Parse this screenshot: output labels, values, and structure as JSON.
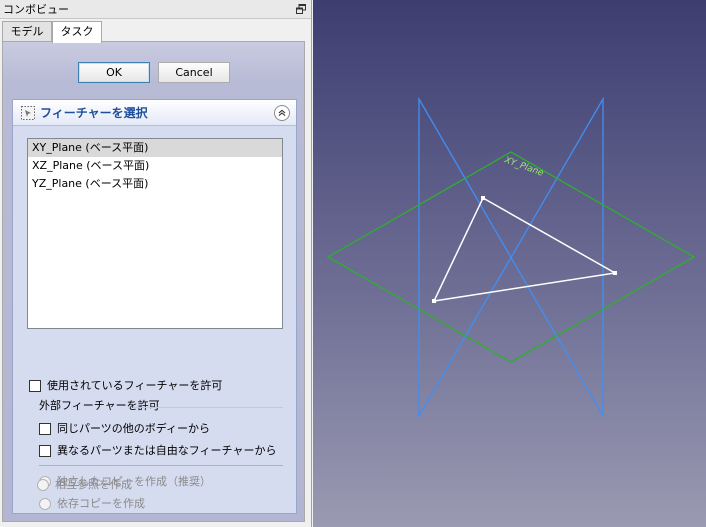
{
  "window": {
    "title": "コンボビュー"
  },
  "tabs": [
    {
      "label": "モデル",
      "active": false
    },
    {
      "label": "タスク",
      "active": true
    }
  ],
  "buttons": {
    "ok": "OK",
    "cancel": "Cancel"
  },
  "feature_box": {
    "title": "フィーチャーを選択",
    "items": [
      {
        "label": "XY_Plane (ベース平面)",
        "selected": true
      },
      {
        "label": "XZ_Plane (ベース平面)",
        "selected": false
      },
      {
        "label": "YZ_Plane (ベース平面)",
        "selected": false
      }
    ],
    "allow_used": {
      "label": "使用されているフィーチャーを許可",
      "checked": false
    },
    "external_group_label": "外部フィーチャーを許可",
    "external_options": [
      {
        "label": "同じパーツの他のボディーから",
        "checked": false
      },
      {
        "label": "異なるパーツまたは自由なフィーチャーから",
        "checked": false
      }
    ],
    "copy_options": [
      {
        "label": "独立したコピーを作成（推奨）",
        "selected": true,
        "enabled": false
      },
      {
        "label": "依存コピーを作成",
        "selected": false,
        "enabled": false
      },
      {
        "label": "相互参照を作成",
        "selected": false,
        "enabled": false
      }
    ]
  },
  "viewport": {
    "plane_labels": {
      "xy": "XY_Plane"
    },
    "colors": {
      "xy_plane": "#2fae2f",
      "other_planes": "#3f8ff5",
      "sketch": "#ffffff"
    }
  }
}
